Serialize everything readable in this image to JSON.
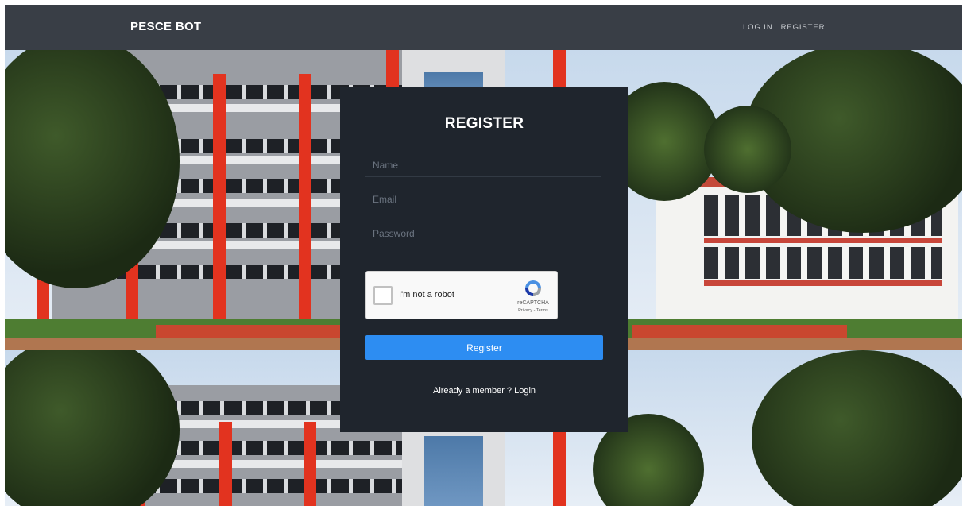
{
  "navbar": {
    "brand": "PESCE BOT",
    "links": [
      {
        "label": "LOG IN"
      },
      {
        "label": "REGISTER"
      }
    ]
  },
  "form": {
    "title": "REGISTER",
    "name_placeholder": "Name",
    "email_placeholder": "Email",
    "password_placeholder": "Password",
    "captcha": {
      "label": "I'm not a robot",
      "brand": "reCAPTCHA",
      "links": "Privacy - Terms"
    },
    "submit_label": "Register",
    "footer_text": "Already a member ?",
    "login_label": "Login"
  },
  "colors": {
    "navbar_bg": "#393e46",
    "card_bg": "#1f252d",
    "button_bg": "#2d8df2"
  }
}
